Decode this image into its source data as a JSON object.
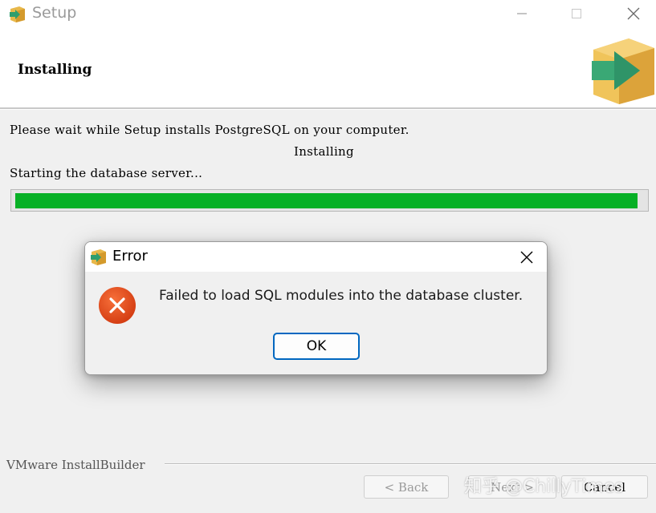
{
  "window": {
    "title": "Setup",
    "app_icon": "installbuilder-box-icon",
    "controls": [
      "minimize",
      "maximize",
      "close"
    ]
  },
  "header": {
    "title": "Installing",
    "logo": "installbuilder-box-arrow-icon"
  },
  "main": {
    "intro": "Please wait while Setup installs PostgreSQL on your computer.",
    "stage": "Installing",
    "status": "Starting the database server...",
    "progress_fraction": 0.99,
    "progress_color": "#06b025"
  },
  "footer": {
    "brand": "VMware InstallBuilder",
    "back_label": "< Back",
    "next_label": "Next >",
    "cancel_label": "Cancel",
    "watermark": "知乎 @ChillyTimes"
  },
  "dialog": {
    "title": "Error",
    "message": "Failed to load SQL modules into the database cluster.",
    "ok_label": "OK",
    "icon": "error-icon",
    "icon_color": "#e0461c",
    "accent_color": "#0067c0"
  }
}
